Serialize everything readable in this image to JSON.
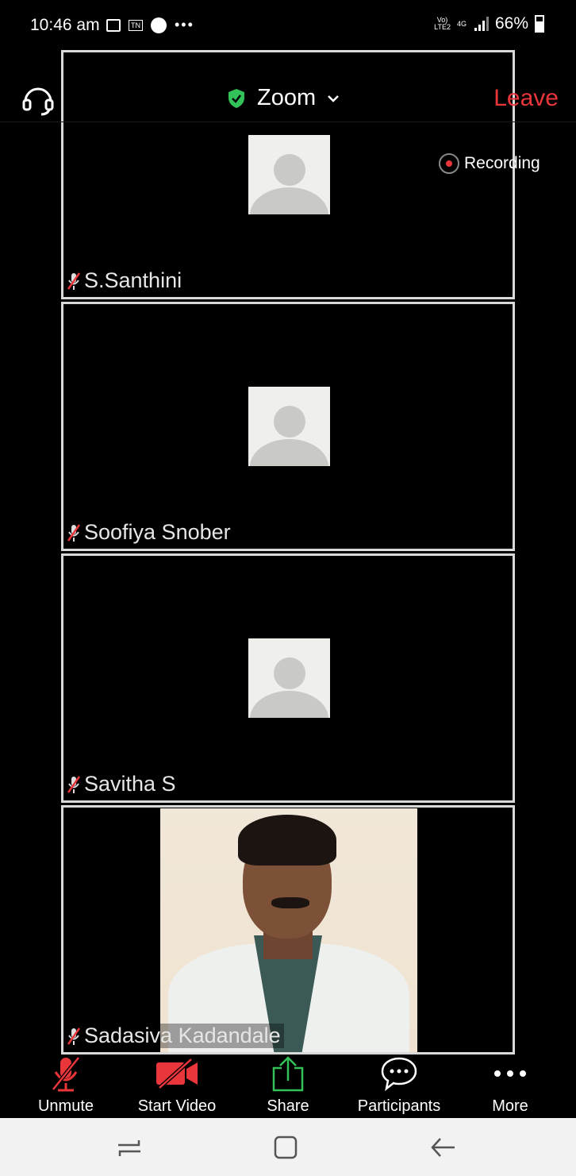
{
  "status_bar": {
    "time": "10:46 am",
    "network_top": "Vo)",
    "network_bottom": "LTE2",
    "net_type": "4G",
    "tn_badge": "TN",
    "battery": "66%"
  },
  "header": {
    "title": "Zoom",
    "leave_label": "Leave",
    "recording_label": "Recording"
  },
  "participants": [
    {
      "name": "S.Santhini"
    },
    {
      "name": "Soofiya Snober"
    },
    {
      "name": "Savitha S"
    },
    {
      "name": "Sadasiva Kadandale"
    }
  ],
  "toolbar": {
    "unmute": "Unmute",
    "start_video": "Start Video",
    "share": "Share",
    "participants": "Participants",
    "more": "More"
  },
  "colors": {
    "leave": "#e8363b",
    "muted": "#e8363b",
    "share": "#33c15a",
    "shield": "#33c15a"
  }
}
